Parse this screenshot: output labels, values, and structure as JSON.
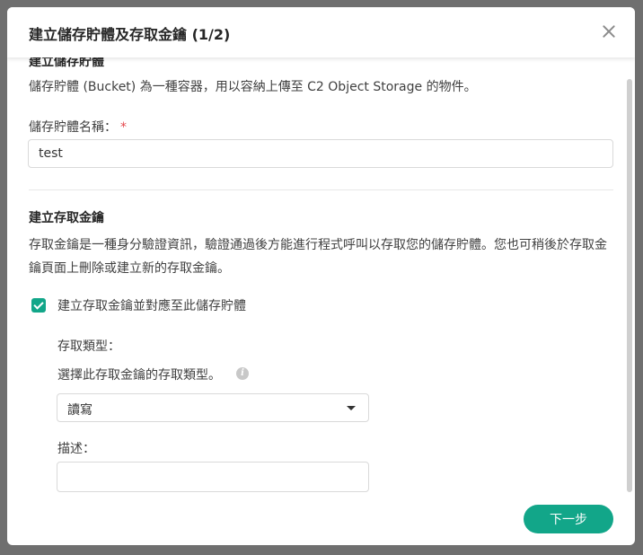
{
  "modal": {
    "title": "建立儲存貯體及存取金鑰 (1/2)",
    "close_icon": "close-icon"
  },
  "bucket": {
    "heading": "建立儲存貯體",
    "description": "儲存貯體 (Bucket) 為一種容器，用以容納上傳至 C2 Object Storage 的物件。",
    "name_label": "儲存貯體名稱：",
    "required_mark": "*",
    "name_value": "test"
  },
  "access_key": {
    "heading": "建立存取金鑰",
    "description": "存取金鑰是一種身分驗證資訊，驗證通過後方能進行程式呼叫以存取您的儲存貯體。您也可稍後於存取金鑰頁面上刪除或建立新的存取金鑰。",
    "checkbox_label": "建立存取金鑰並對應至此儲存貯體",
    "checkbox_checked": true,
    "type_label": "存取類型：",
    "type_hint": "選擇此存取金鑰的存取類型。",
    "info_icon": "info-icon",
    "type_value": "讀寫",
    "desc_label": "描述：",
    "desc_value": ""
  },
  "footer": {
    "next_label": "下一步"
  },
  "colors": {
    "accent": "#12a689",
    "required": "#e5484d",
    "overlay": "#6f6f6f"
  }
}
